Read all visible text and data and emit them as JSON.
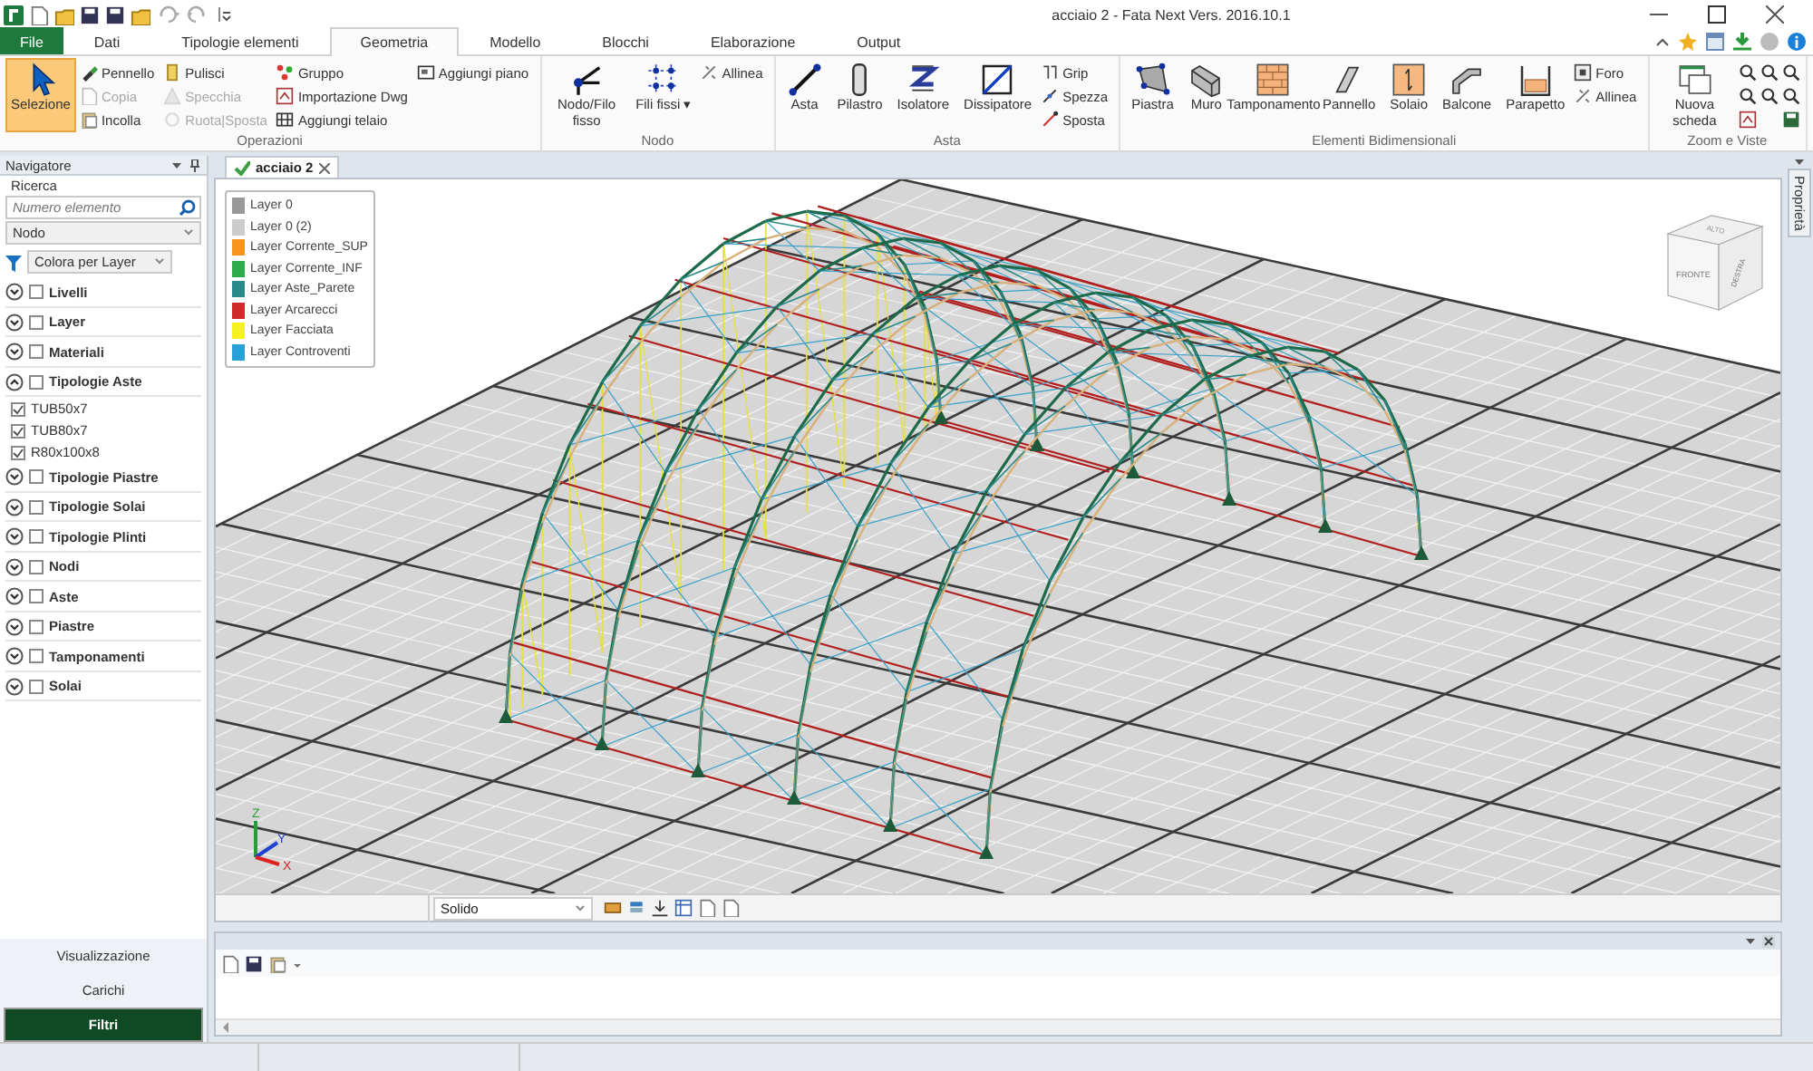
{
  "window": {
    "title": "acciaio 2 - Fata Next Vers. 2016.10.1"
  },
  "tabs": [
    {
      "label": "File",
      "kind": "file",
      "selected": false
    },
    {
      "label": "Dati",
      "kind": "tab",
      "selected": false
    },
    {
      "label": "Tipologie elementi",
      "kind": "tab",
      "selected": false
    },
    {
      "label": "Geometria",
      "kind": "tab",
      "selected": true
    },
    {
      "label": "Modello",
      "kind": "tab",
      "selected": false
    },
    {
      "label": "Blocchi",
      "kind": "tab",
      "selected": false
    },
    {
      "label": "Elaborazione",
      "kind": "tab",
      "selected": false
    },
    {
      "label": "Output",
      "kind": "tab",
      "selected": false
    }
  ],
  "ribbon": [
    {
      "title": "Operazioni",
      "columns": [
        {
          "kind": "big",
          "label": "Selezione",
          "selected": true
        },
        {
          "kind": "stack",
          "items": [
            {
              "label": "Pennello",
              "disabled": false
            },
            {
              "label": "Copia",
              "disabled": true
            },
            {
              "label": "Incolla",
              "disabled": false
            }
          ]
        },
        {
          "kind": "stack",
          "items": [
            {
              "label": "Pulisci",
              "disabled": false
            },
            {
              "label": "Specchia",
              "disabled": true
            },
            {
              "label": "Ruota|Sposta",
              "disabled": true
            }
          ]
        },
        {
          "kind": "stack",
          "items": [
            {
              "label": "Gruppo",
              "disabled": false
            },
            {
              "label": "Importazione Dwg",
              "disabled": false
            },
            {
              "label": "Aggiungi telaio",
              "disabled": false
            }
          ]
        },
        {
          "kind": "stack",
          "items": [
            {
              "label": "Aggiungi piano",
              "disabled": false
            }
          ]
        }
      ]
    },
    {
      "title": "Nodo",
      "columns": [
        {
          "kind": "big",
          "label": "Nodo/Filo fisso",
          "selected": false
        },
        {
          "kind": "big",
          "label": "Fili fissi ▾",
          "selected": false
        },
        {
          "kind": "stack",
          "items": [
            {
              "label": "Allinea",
              "disabled": false
            }
          ]
        }
      ]
    },
    {
      "title": "Asta",
      "columns": [
        {
          "kind": "big",
          "label": "Asta",
          "selected": false
        },
        {
          "kind": "big",
          "label": "Pilastro",
          "selected": false
        },
        {
          "kind": "big",
          "label": "Isolatore",
          "selected": false
        },
        {
          "kind": "big",
          "label": "Dissipatore",
          "selected": false
        },
        {
          "kind": "stack",
          "items": [
            {
              "label": "Grip",
              "disabled": false
            },
            {
              "label": "Spezza",
              "disabled": false
            },
            {
              "label": "Sposta",
              "disabled": false
            }
          ]
        }
      ]
    },
    {
      "title": "Elementi Bidimensionali",
      "columns": [
        {
          "kind": "big",
          "label": "Piastra",
          "selected": false
        },
        {
          "kind": "big",
          "label": "Muro",
          "selected": false
        },
        {
          "kind": "big",
          "label": "Tamponamento",
          "selected": false
        },
        {
          "kind": "big",
          "label": "Pannello",
          "selected": false
        },
        {
          "kind": "big",
          "label": "Solaio",
          "selected": false
        },
        {
          "kind": "big",
          "label": "Balcone",
          "selected": false
        },
        {
          "kind": "big",
          "label": "Parapetto",
          "selected": false
        },
        {
          "kind": "stack",
          "items": [
            {
              "label": "Foro",
              "disabled": false
            },
            {
              "label": "Allinea",
              "disabled": false
            }
          ]
        }
      ]
    },
    {
      "title": "Zoom e Viste",
      "columns": [
        {
          "kind": "big",
          "label": "Nuova scheda",
          "selected": false
        },
        {
          "kind": "icons"
        },
        {
          "kind": "icons"
        },
        {
          "kind": "icons"
        }
      ]
    }
  ],
  "navigator": {
    "title": "Navigatore",
    "search_label": "Ricerca",
    "search": {
      "placeholder": "Numero elemento"
    },
    "element_type": "Nodo",
    "color_mode": "Colora per Layer",
    "sections": [
      {
        "label": "Livelli",
        "expanded": false,
        "checked": false
      },
      {
        "label": "Layer",
        "expanded": false,
        "checked": false
      },
      {
        "label": "Materiali",
        "expanded": false,
        "checked": false
      },
      {
        "label": "Tipologie Aste",
        "expanded": true,
        "checked": false,
        "children": [
          {
            "label": "TUB50x7",
            "checked": true
          },
          {
            "label": "TUB80x7",
            "checked": true
          },
          {
            "label": "R80x100x8",
            "checked": true
          }
        ]
      },
      {
        "label": "Tipologie Piastre",
        "expanded": false,
        "checked": false
      },
      {
        "label": "Tipologie Solai",
        "expanded": false,
        "checked": false
      },
      {
        "label": "Tipologie Plinti",
        "expanded": false,
        "checked": false
      },
      {
        "label": "Nodi",
        "expanded": false,
        "checked": false
      },
      {
        "label": "Aste",
        "expanded": false,
        "checked": false
      },
      {
        "label": "Piastre",
        "expanded": false,
        "checked": false
      },
      {
        "label": "Tamponamenti",
        "expanded": false,
        "checked": false
      },
      {
        "label": "Solai",
        "expanded": false,
        "checked": false
      }
    ],
    "panels": [
      {
        "label": "Visualizzazione",
        "selected": false
      },
      {
        "label": "Carichi",
        "selected": false
      },
      {
        "label": "Filtri",
        "selected": true
      }
    ]
  },
  "document_tab": {
    "label": "acciaio 2"
  },
  "legend": [
    {
      "label": "Layer 0",
      "color": "#999999"
    },
    {
      "label": "Layer 0 (2)",
      "color": "#cccccc"
    },
    {
      "label": "Layer Corrente_SUP",
      "color": "#f7941d"
    },
    {
      "label": "Layer Corrente_INF",
      "color": "#2eaa4a"
    },
    {
      "label": "Layer Aste_Parete",
      "color": "#2a8a8a"
    },
    {
      "label": "Layer Arcarecci",
      "color": "#d02a2a"
    },
    {
      "label": "Layer Facciata",
      "color": "#f5f020"
    },
    {
      "label": "Layer Controventi",
      "color": "#2aa0d8"
    }
  ],
  "view_cube": {
    "top": "ALTO",
    "front": "FRONTE",
    "right": "DESTRA"
  },
  "axes": {
    "x": "X",
    "y": "Y",
    "z": "Z"
  },
  "view_bar": {
    "display_mode": "Solido"
  },
  "side_tab": "Proprietà"
}
